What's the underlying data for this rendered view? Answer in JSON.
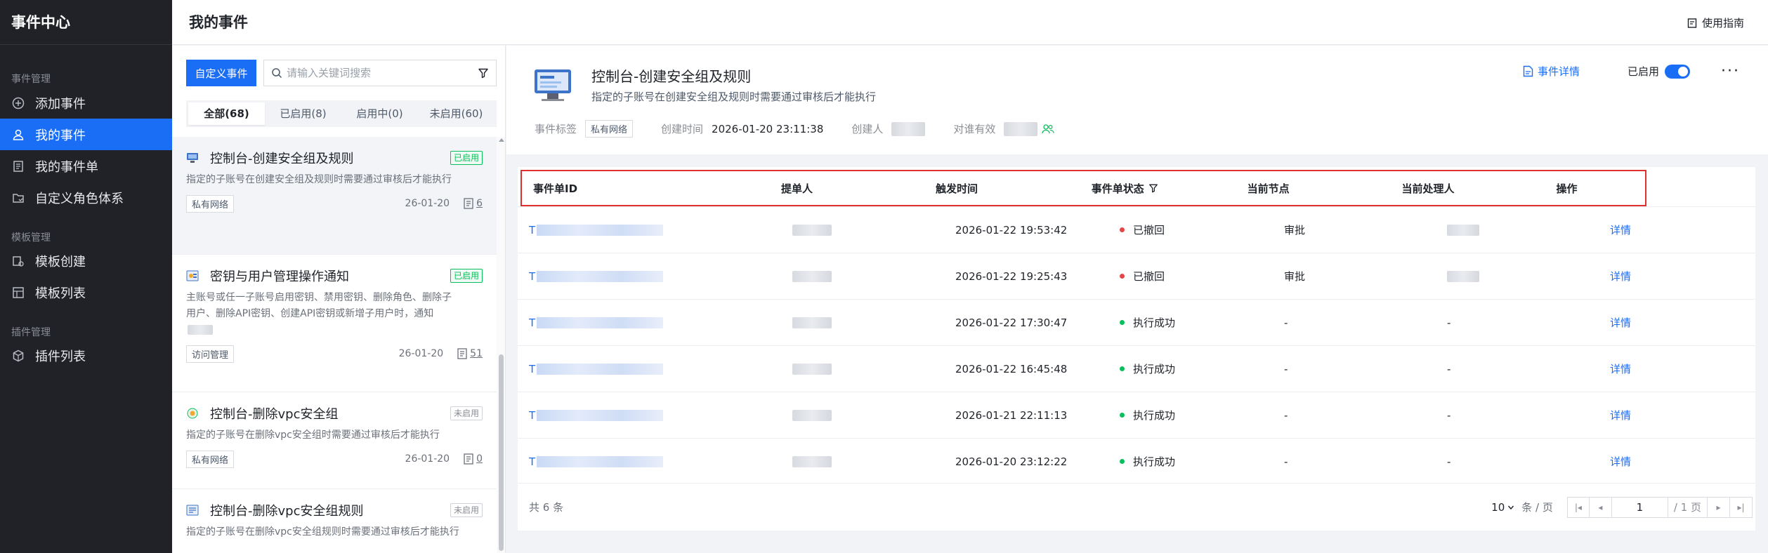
{
  "sidebar": {
    "brand": "事件中心",
    "groups": [
      {
        "label": "事件管理"
      },
      {
        "label": "模板管理"
      },
      {
        "label": "插件管理"
      }
    ],
    "items": [
      {
        "label": "添加事件",
        "icon": "plus-circle-icon"
      },
      {
        "label": "我的事件",
        "icon": "user-icon",
        "active": true
      },
      {
        "label": "我的事件单",
        "icon": "document-icon"
      },
      {
        "label": "自定义角色体系",
        "icon": "folder-icon"
      },
      {
        "label": "模板创建",
        "icon": "template-create-icon"
      },
      {
        "label": "模板列表",
        "icon": "template-list-icon"
      },
      {
        "label": "插件列表",
        "icon": "cube-icon"
      }
    ]
  },
  "header": {
    "title": "我的事件",
    "guide_label": "使用指南"
  },
  "list": {
    "custom_button": "自定义事件",
    "search_placeholder": "请输入关键词搜索",
    "tabs": [
      {
        "label": "全部(68)",
        "active": true
      },
      {
        "label": "已启用(8)"
      },
      {
        "label": "启用中(0)"
      },
      {
        "label": "未启用(60)"
      }
    ],
    "cards": [
      {
        "title": "控制台-创建安全组及规则",
        "status": "已启用",
        "desc": "指定的子账号在创建安全组及规则时需要通过审核后才能执行",
        "tag": "私有网络",
        "date": "26-01-20",
        "count": "6"
      },
      {
        "title": "密钥与用户管理操作通知",
        "status": "已启用",
        "desc": "主账号或任一子账号启用密钥、禁用密钥、删除角色、删除子用户、删除API密钥、创建API密钥或新增子用户时，通知",
        "tag": "访问管理",
        "date": "26-01-20",
        "count": "51"
      },
      {
        "title": "控制台-删除vpc安全组",
        "status": "未启用",
        "desc": "指定的子账号在删除vpc安全组时需要通过审核后才能执行",
        "tag": "私有网络",
        "date": "26-01-20",
        "count": "0"
      },
      {
        "title": "控制台-删除vpc安全组规则",
        "status": "未启用",
        "desc": "指定的子账号在删除vpc安全组规则时需要通过审核后才能执行"
      }
    ]
  },
  "detail": {
    "title": "控制台-创建安全组及规则",
    "desc": "指定的子账号在创建安全组及规则时需要通过审核后才能执行",
    "tag_label": "事件标签",
    "tag_value": "私有网络",
    "created_label": "创建时间",
    "created_value": "2026-01-20 23:11:38",
    "creator_label": "创建人",
    "scope_label": "对谁有效",
    "detail_link": "事件详情",
    "enabled_label": "已启用",
    "more": "···"
  },
  "table": {
    "columns": [
      "事件单ID",
      "提单人",
      "触发时间",
      "事件单状态",
      "当前节点",
      "当前处理人",
      "操作"
    ],
    "rows": [
      {
        "id": "T",
        "time": "2026-01-22 19:53:42",
        "status": "已撤回",
        "status_color": "#e54545",
        "node": "审批",
        "action": "详情"
      },
      {
        "id": "T",
        "time": "2026-01-22 19:25:43",
        "status": "已撤回",
        "status_color": "#e54545",
        "node": "审批",
        "action": "详情"
      },
      {
        "id": "T",
        "time": "2026-01-22 17:30:47",
        "status": "执行成功",
        "status_color": "#0abf5b",
        "node": "-",
        "handler": "-",
        "action": "详情"
      },
      {
        "id": "T",
        "time": "2026-01-22 16:45:48",
        "status": "执行成功",
        "status_color": "#0abf5b",
        "node": "-",
        "handler": "-",
        "action": "详情"
      },
      {
        "id": "T",
        "time": "2026-01-21 22:11:13",
        "status": "执行成功",
        "status_color": "#0abf5b",
        "node": "-",
        "handler": "-",
        "action": "详情"
      },
      {
        "id": "T",
        "time": "2026-01-20 23:12:22",
        "status": "执行成功",
        "status_color": "#0abf5b",
        "node": "-",
        "handler": "-",
        "action": "详情"
      }
    ],
    "total": "共 6 条",
    "page_size": "10",
    "page_size_unit": "条 / 页",
    "page": "1",
    "page_total": "/ 1 页"
  },
  "colors": {
    "accent": "#1a6df5",
    "sidebar_bg": "#202227",
    "enabled": "#0abf5b",
    "withdrawn": "#e54545",
    "highlight_border": "#e0302d"
  }
}
